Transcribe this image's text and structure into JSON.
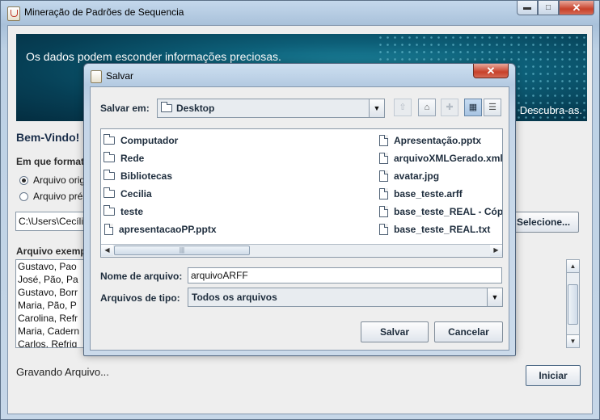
{
  "window": {
    "title": "Mineração de Padrões de Sequencia",
    "min_glyph": "▬",
    "max_glyph": "□",
    "close_glyph": "✕"
  },
  "banner": {
    "text": "Os dados podem esconder informações preciosas.",
    "slogan": "Descubra-as."
  },
  "main": {
    "welcome": "Bem-Vindo!",
    "format_question": "Em que format",
    "radio_options": [
      "Arquivo orig",
      "Arquivo pré"
    ],
    "path_value": "C:\\Users\\Cecíli",
    "select_button": "Selecione...",
    "example_label": "Arquivo exemp",
    "example_lines": [
      "Gustavo, Pao",
      "José, Pão, Pa",
      "Gustavo, Borr",
      "Maria, Pão, P",
      "Carolina, Refr",
      "Maria, Cadern",
      "Carlos, Refrig"
    ],
    "status": "Gravando Arquivo...",
    "start_button": "Iniciar",
    "scroll_up": "▲",
    "scroll_down": "▼"
  },
  "dialog": {
    "title": "Salvar",
    "close_glyph": "✕",
    "save_in_label": "Salvar em:",
    "save_in_value": "Desktop",
    "combo_arrow": "▼",
    "toolbar_glyphs": [
      "⇧",
      "⌂",
      "✚",
      "▦",
      "☰"
    ],
    "files": [
      {
        "name": "Computador",
        "icon": "folder-icon"
      },
      {
        "name": "Rede",
        "icon": "folder-icon"
      },
      {
        "name": "Bibliotecas",
        "icon": "folder-icon"
      },
      {
        "name": "Cecilia",
        "icon": "folder-icon"
      },
      {
        "name": "teste",
        "icon": "folder-icon"
      },
      {
        "name": "apresentacaoPP.pptx",
        "icon": "file-icon"
      },
      {
        "name": "Apresentação.pptx",
        "icon": "file-icon"
      },
      {
        "name": "arquivoXMLGerado.xml",
        "icon": "file-icon"
      },
      {
        "name": "avatar.jpg",
        "icon": "file-icon"
      },
      {
        "name": "base_teste.arff",
        "icon": "file-icon"
      },
      {
        "name": "base_teste_REAL - Cópi",
        "icon": "file-icon"
      },
      {
        "name": "base_teste_REAL.txt",
        "icon": "file-icon"
      }
    ],
    "hscroll_left": "◀",
    "hscroll_right": "▶",
    "hscroll_grip": "|||",
    "file_name_label": "Nome de arquivo:",
    "file_name_value": "arquivoARFF",
    "file_type_label": "Arquivos de tipo:",
    "file_type_value": "Todos os arquivos",
    "save_button": "Salvar",
    "cancel_button": "Cancelar"
  }
}
